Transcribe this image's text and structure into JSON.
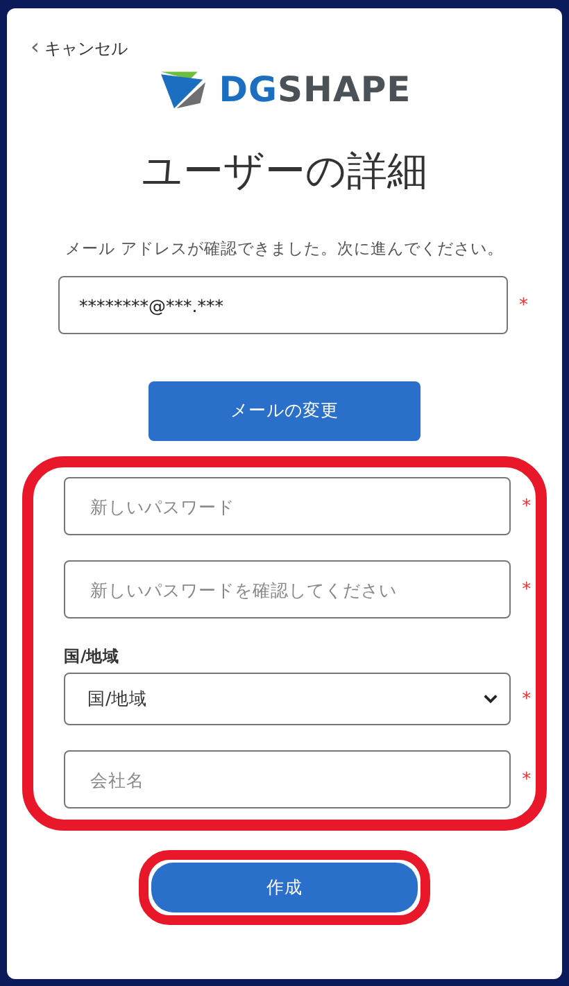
{
  "cancel_link": {
    "icon": "‹",
    "label": "キャンセル"
  },
  "logo": {
    "accent_text": "DG",
    "text": "SHAPE"
  },
  "title": "ユーザーの詳細",
  "message": "メール アドレスが確認できました。次に進んでください。",
  "email_field": {
    "value": "********@***.***",
    "required_mark": "*"
  },
  "change_email_button": "メールの変更",
  "form_group": {
    "highlighted": true,
    "fields": [
      {
        "kind": "text",
        "placeholder": "新しいパスワード",
        "required_mark": "*"
      },
      {
        "kind": "text",
        "placeholder": "新しいパスワードを確認してください",
        "required_mark": "*"
      },
      {
        "kind": "select",
        "label": "国/地域",
        "value": "国/地域",
        "required_mark": "*"
      },
      {
        "kind": "text",
        "placeholder": "会社名",
        "required_mark": "*"
      }
    ]
  },
  "create_button": {
    "label": "作成",
    "highlighted": true
  }
}
